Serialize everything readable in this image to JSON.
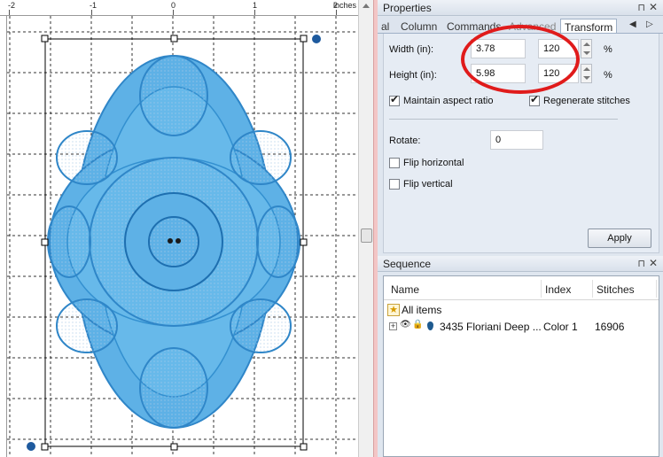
{
  "canvas": {
    "ruler_unit": "inches",
    "ruler_numbers": [
      "-2",
      "-1",
      "0",
      "1",
      "2"
    ]
  },
  "properties": {
    "title": "Properties",
    "pin_icon": "pin-icon",
    "close_icon": "close-icon",
    "tabs": [
      "al",
      "Column",
      "Commands",
      "Advanced",
      "Transform"
    ],
    "active_tab": "Transform",
    "width_label": "Width (in):",
    "width_value": "3.78",
    "width_percent": "120",
    "height_label": "Height (in):",
    "height_value": "5.98",
    "height_percent": "120",
    "percent_sign": "%",
    "maintain_aspect": "Maintain aspect ratio",
    "regenerate": "Regenerate stitches",
    "rotate_label": "Rotate:",
    "rotate_value": "0",
    "flip_h": "Flip horizontal",
    "flip_v": "Flip vertical",
    "apply": "Apply"
  },
  "sequence": {
    "title": "Sequence",
    "columns": [
      "Name",
      "Index",
      "Stitches"
    ],
    "all_items": "All items",
    "rows": [
      {
        "name": "3435 Floriani Deep ...",
        "index": "Color 1",
        "stitches": "16906"
      }
    ]
  },
  "colors": {
    "embroidery": "#4aa3df",
    "annotation": "#e01b1b",
    "accent": "#1e5a8f"
  }
}
